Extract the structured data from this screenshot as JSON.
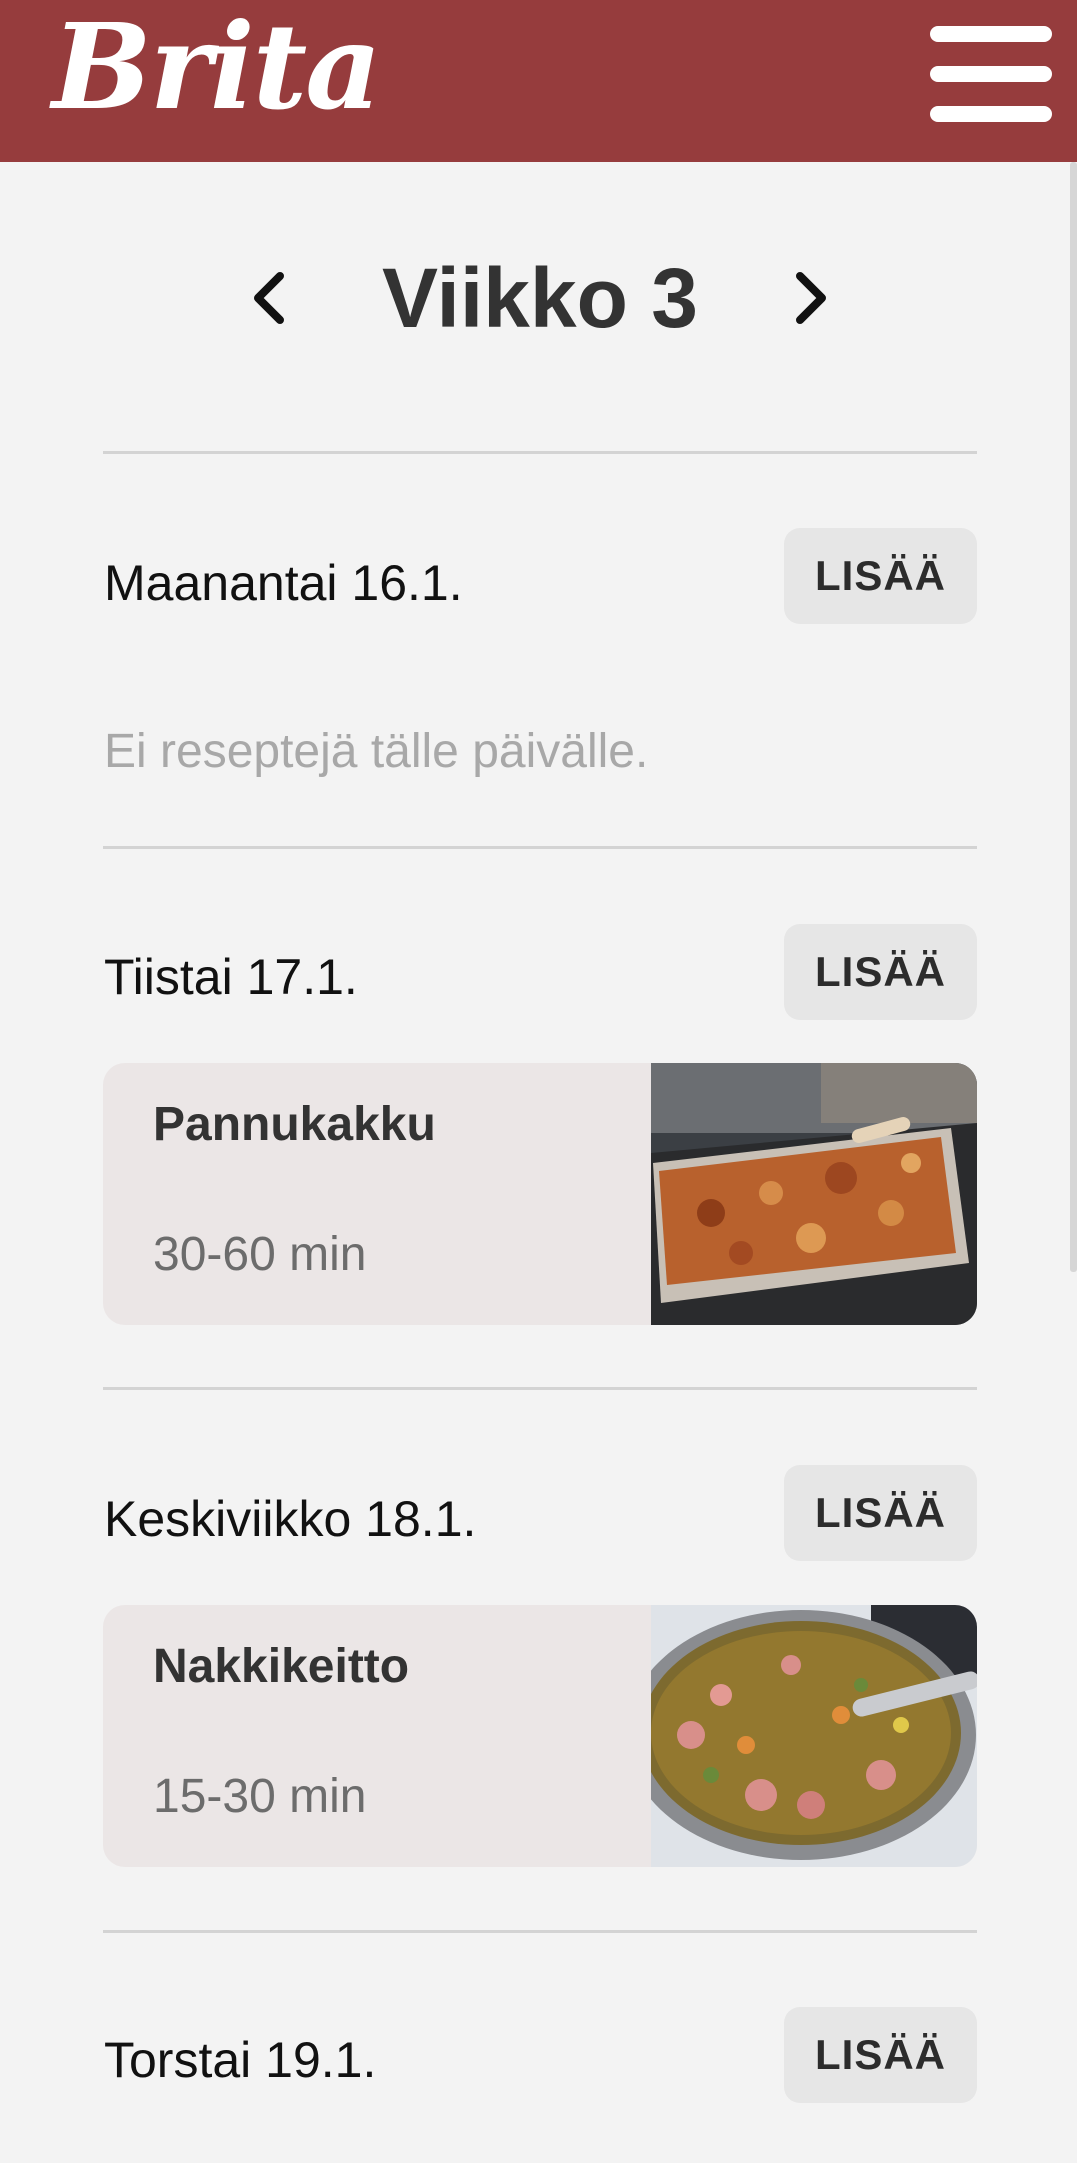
{
  "app": {
    "logo_text": "Brita"
  },
  "header": {
    "menu_icon": "hamburger-menu-icon"
  },
  "week": {
    "title": "Viikko 3",
    "prev_icon": "chevron-left-icon",
    "next_icon": "chevron-right-icon"
  },
  "days": [
    {
      "title": "Maanantai 16.1.",
      "add_label": "LISÄÄ",
      "empty_text": "Ei reseptejä tälle päivälle."
    },
    {
      "title": "Tiistai 17.1.",
      "add_label": "LISÄÄ",
      "recipe": {
        "name": "Pannukakku",
        "time": "30-60 min"
      }
    },
    {
      "title": "Keskiviikko 18.1.",
      "add_label": "LISÄÄ",
      "recipe": {
        "name": "Nakkikeitto",
        "time": "15-30 min"
      }
    },
    {
      "title": "Torstai 19.1.",
      "add_label": "LISÄÄ"
    }
  ],
  "colors": {
    "brand": "#963c3d",
    "card": "#ebe6e6",
    "button": "#e6e6e6"
  }
}
